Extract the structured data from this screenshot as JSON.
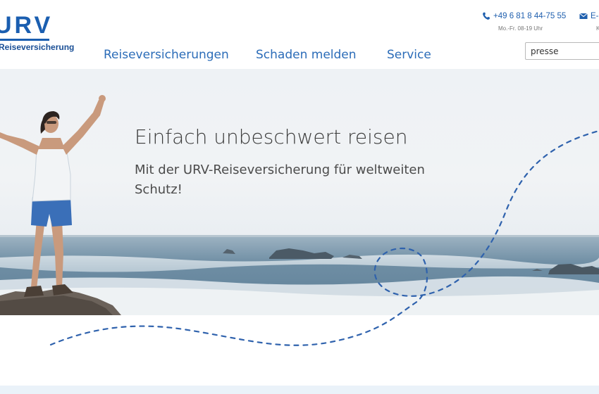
{
  "brand": {
    "logo_text": "URV",
    "logo_subtitle": "Reiseversicherung"
  },
  "contact": {
    "phone": "+49 6 81 8 44-75 55",
    "hours": "Mo.-Fr. 08-19 Uhr",
    "mail_label": "E-Mail",
    "mail_sub": "K"
  },
  "nav": {
    "items": [
      "Reiseversicherungen",
      "Schaden melden",
      "Service"
    ]
  },
  "search": {
    "value": "presse"
  },
  "hero": {
    "title": "Einfach unbeschwert reisen",
    "subtitle": "Mit der URV-Reiseversicherung für weltweiten Schutz!"
  },
  "colors": {
    "brand_blue": "#1a5eb0",
    "nav_blue": "#2b6cb8",
    "dash_blue": "#2f62ad"
  }
}
